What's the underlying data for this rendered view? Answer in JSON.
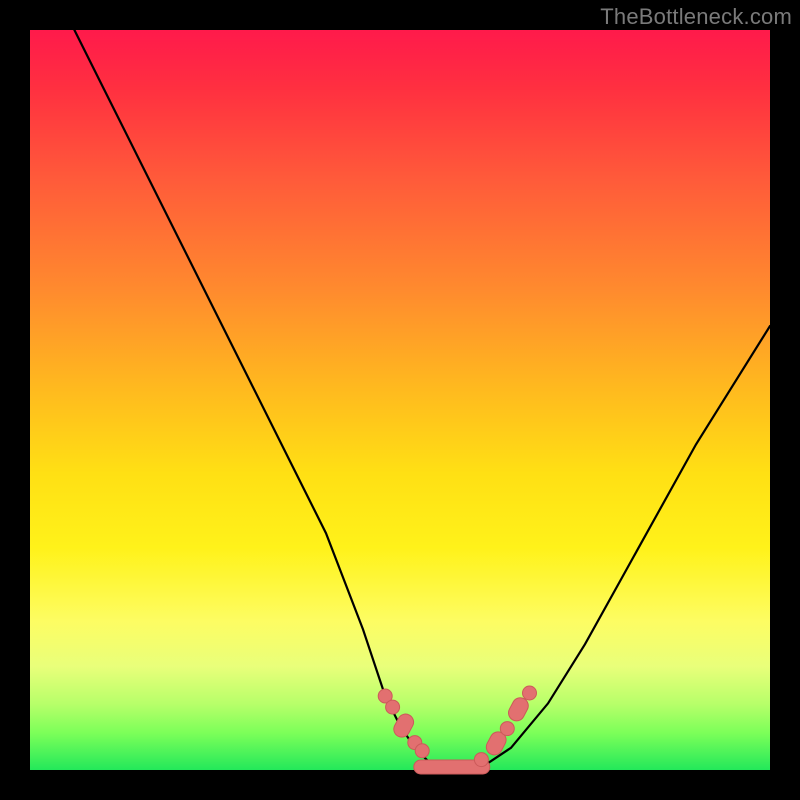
{
  "watermark": "TheBottleneck.com",
  "colors": {
    "frame": "#000000",
    "gradient_top": "#ff1a4b",
    "gradient_mid": "#ffe014",
    "gradient_bottom": "#23e85a",
    "curve": "#000000",
    "marker": "#e27070"
  },
  "chart_data": {
    "type": "line",
    "title": "",
    "xlabel": "",
    "ylabel": "",
    "xlim": [
      0,
      100
    ],
    "ylim": [
      0,
      100
    ],
    "grid": false,
    "legend": false,
    "series": [
      {
        "name": "bottleneck-curve",
        "x": [
          6,
          10,
          15,
          20,
          25,
          30,
          35,
          40,
          45,
          48,
          50,
          52,
          54,
          56,
          58,
          60,
          62,
          65,
          70,
          75,
          80,
          85,
          90,
          95,
          100
        ],
        "y": [
          100,
          92,
          82,
          72,
          62,
          52,
          42,
          32,
          19,
          10,
          6,
          3,
          1,
          0,
          0,
          0,
          1,
          3,
          9,
          17,
          26,
          35,
          44,
          52,
          60
        ]
      }
    ],
    "markers": [
      {
        "name": "left-dot-1",
        "x": 48.0,
        "y": 10.0,
        "shape": "circle"
      },
      {
        "name": "left-dot-2",
        "x": 49.0,
        "y": 8.5,
        "shape": "circle"
      },
      {
        "name": "left-pill-1",
        "x": 50.5,
        "y": 6.0,
        "shape": "pill"
      },
      {
        "name": "left-dot-3",
        "x": 52.0,
        "y": 3.7,
        "shape": "circle"
      },
      {
        "name": "left-dot-4",
        "x": 53.0,
        "y": 2.6,
        "shape": "circle"
      },
      {
        "name": "trough-pill",
        "x": 57.0,
        "y": 0.4,
        "shape": "long-pill"
      },
      {
        "name": "right-dot-1",
        "x": 61.0,
        "y": 1.4,
        "shape": "circle"
      },
      {
        "name": "right-pill-1",
        "x": 63.0,
        "y": 3.6,
        "shape": "pill"
      },
      {
        "name": "right-dot-2",
        "x": 64.5,
        "y": 5.6,
        "shape": "circle"
      },
      {
        "name": "right-pill-2",
        "x": 66.0,
        "y": 8.2,
        "shape": "pill"
      },
      {
        "name": "right-dot-3",
        "x": 67.5,
        "y": 10.4,
        "shape": "circle"
      }
    ]
  }
}
